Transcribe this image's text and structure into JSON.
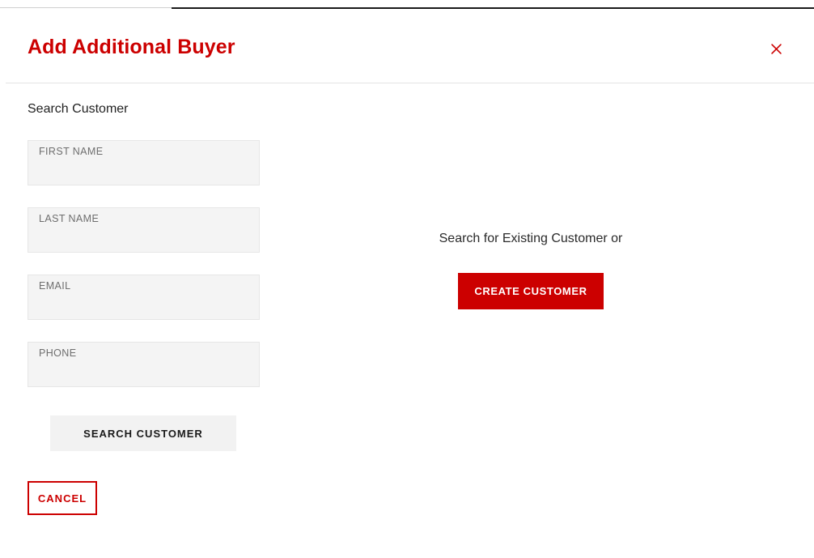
{
  "modal": {
    "title": "Add Additional Buyer",
    "close_icon": "close-icon",
    "accent_color": "#cc0000"
  },
  "search": {
    "section_title": "Search Customer",
    "fields": [
      {
        "label": "FIRST NAME",
        "value": ""
      },
      {
        "label": "LAST NAME",
        "value": ""
      },
      {
        "label": "EMAIL",
        "value": ""
      },
      {
        "label": "PHONE",
        "value": ""
      }
    ],
    "search_button_label": "SEARCH CUSTOMER"
  },
  "actions": {
    "cancel_label": "CANCEL"
  },
  "create": {
    "prompt_text": "Search for Existing Customer or",
    "create_button_label": "CREATE CUSTOMER"
  }
}
